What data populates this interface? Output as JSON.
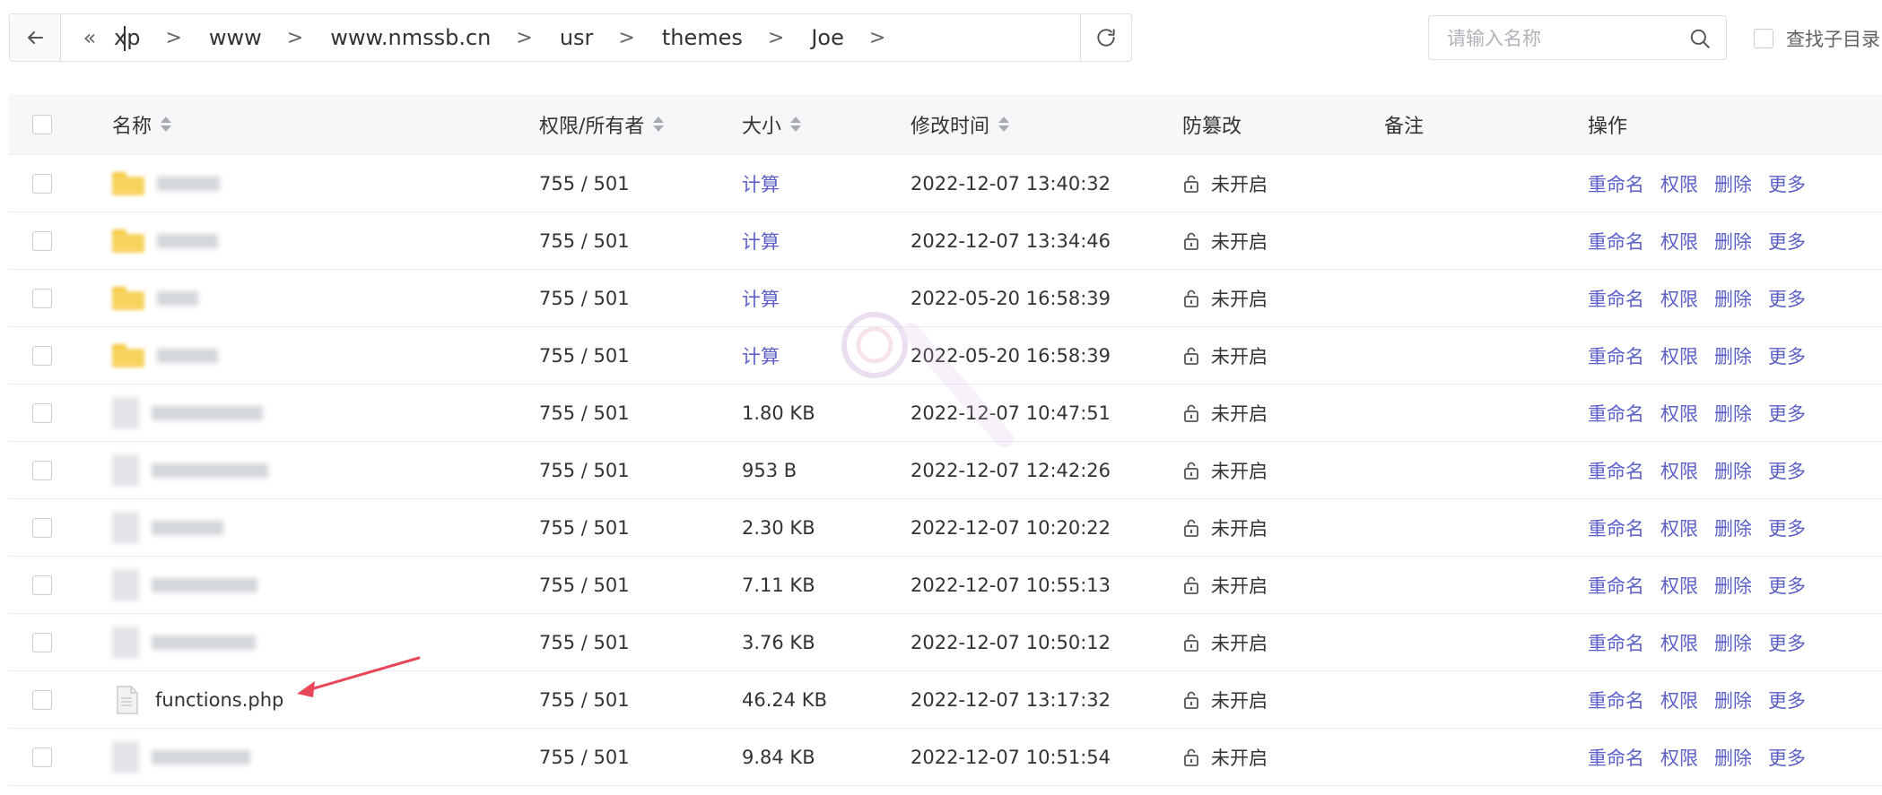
{
  "pathbar": {
    "back_icon": "arrow-left-icon",
    "collapse_icon": "double-chevron-left-icon",
    "collapse_label": "«",
    "crumbs": [
      "xp",
      "www",
      "www.nmssb.cn",
      "usr",
      "themes",
      "Joe"
    ],
    "separator": ">",
    "refresh_icon": "refresh-icon"
  },
  "search": {
    "placeholder": "请输入名称",
    "value": "",
    "icon": "search-icon"
  },
  "subdir_label": "查找子目录",
  "table": {
    "headers": {
      "name": "名称",
      "perm": "权限/所有者",
      "size": "大小",
      "mtime": "修改时间",
      "tamper": "防篡改",
      "note": "备注",
      "ops": "操作"
    },
    "ops": {
      "rename": "重命名",
      "perm": "权限",
      "delete": "删除",
      "more": "更多"
    },
    "rows": [
      {
        "type": "folder",
        "name": "",
        "perm": "755 / 501",
        "size": "计算",
        "mtime": "2022-12-07 13:40:32",
        "tamper": "未开启"
      },
      {
        "type": "folder",
        "name": "",
        "perm": "755 / 501",
        "size": "计算",
        "mtime": "2022-12-07 13:34:46",
        "tamper": "未开启"
      },
      {
        "type": "folder",
        "name": "",
        "perm": "755 / 501",
        "size": "计算",
        "mtime": "2022-05-20 16:58:39",
        "tamper": "未开启"
      },
      {
        "type": "folder",
        "name": "",
        "perm": "755 / 501",
        "size": "计算",
        "mtime": "2022-05-20 16:58:39",
        "tamper": "未开启"
      },
      {
        "type": "file",
        "name": "",
        "perm": "755 / 501",
        "size": "1.80 KB",
        "mtime": "2022-12-07 10:47:51",
        "tamper": "未开启"
      },
      {
        "type": "file",
        "name": "",
        "perm": "755 / 501",
        "size": "953 B",
        "mtime": "2022-12-07 12:42:26",
        "tamper": "未开启"
      },
      {
        "type": "file",
        "name": "",
        "perm": "755 / 501",
        "size": "2.30 KB",
        "mtime": "2022-12-07 10:20:22",
        "tamper": "未开启"
      },
      {
        "type": "file",
        "name": "",
        "perm": "755 / 501",
        "size": "7.11 KB",
        "mtime": "2022-12-07 10:55:13",
        "tamper": "未开启"
      },
      {
        "type": "file",
        "name": "",
        "perm": "755 / 501",
        "size": "3.76 KB",
        "mtime": "2022-12-07 10:50:12",
        "tamper": "未开启"
      },
      {
        "type": "file",
        "name": "functions.php",
        "perm": "755 / 501",
        "size": "46.24 KB",
        "mtime": "2022-12-07 13:17:32",
        "tamper": "未开启"
      },
      {
        "type": "file",
        "name": "",
        "perm": "755 / 501",
        "size": "9.84 KB",
        "mtime": "2022-12-07 10:51:54",
        "tamper": "未开启"
      }
    ]
  },
  "annotation": {
    "type": "arrow",
    "color": "#e8475a"
  },
  "colors": {
    "link": "#5b5fc7",
    "header_bg": "#f6f7f9",
    "folder": "#f7d35f"
  }
}
